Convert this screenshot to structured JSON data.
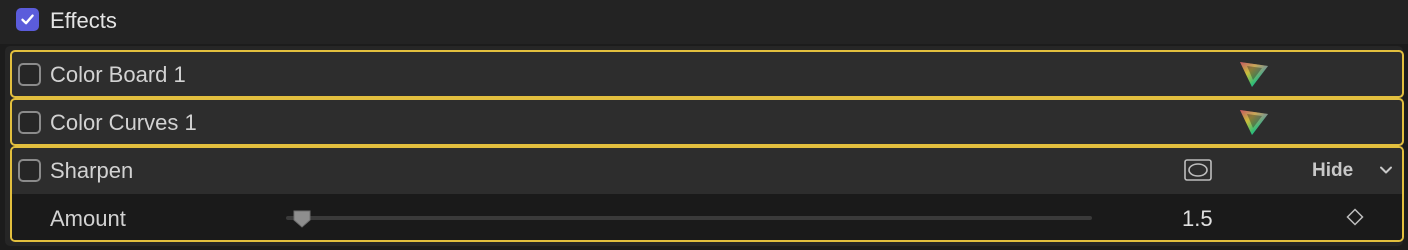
{
  "effects": {
    "title": "Effects",
    "enabled": true,
    "accent_color": "#5b5cdb",
    "selection_color": "#e2bf3e",
    "items": [
      {
        "name": "Color Board 1",
        "enabled": false,
        "icon": "color-wheel-icon"
      },
      {
        "name": "Color Curves 1",
        "enabled": false,
        "icon": "color-wheel-icon"
      }
    ],
    "sharpen": {
      "name": "Sharpen",
      "enabled": false,
      "mask_icon": "shape-mask-icon",
      "hide_label": "Hide",
      "chevron_icon": "chevron-down-icon",
      "params": [
        {
          "label": "Amount",
          "value": "1.5",
          "slider_fraction": 0.02,
          "keyframe_icon": "keyframe-diamond-icon"
        }
      ]
    }
  }
}
